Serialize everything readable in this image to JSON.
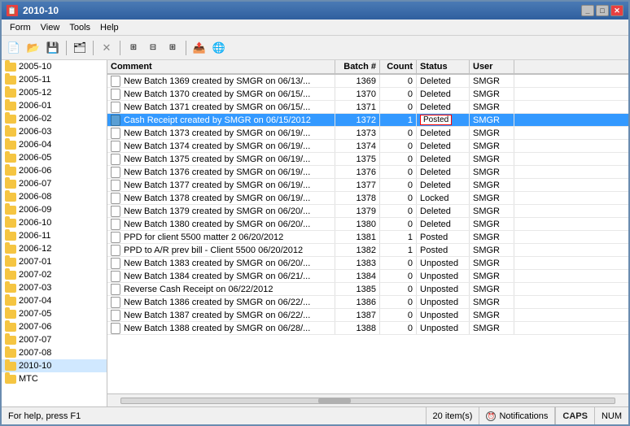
{
  "window": {
    "title": "2010-10",
    "icon": "🗒"
  },
  "menu": {
    "items": [
      "Form",
      "View",
      "Tools",
      "Help"
    ]
  },
  "toolbar": {
    "buttons": [
      "new",
      "open",
      "save",
      "separator",
      "folder",
      "separator",
      "delete",
      "separator",
      "grid1",
      "grid2",
      "grid3",
      "separator",
      "export",
      "globe"
    ]
  },
  "sidebar": {
    "items": [
      "2005-10",
      "2005-11",
      "2005-12",
      "2006-01",
      "2006-02",
      "2006-03",
      "2006-04",
      "2006-05",
      "2006-06",
      "2006-07",
      "2006-08",
      "2006-09",
      "2006-10",
      "2006-11",
      "2006-12",
      "2007-01",
      "2007-02",
      "2007-03",
      "2007-04",
      "2007-05",
      "2007-06",
      "2007-07",
      "2007-08",
      "2010-10",
      "MTC"
    ],
    "selected": "2010-10"
  },
  "table": {
    "columns": [
      {
        "key": "comment",
        "label": "Comment"
      },
      {
        "key": "batch",
        "label": "Batch #"
      },
      {
        "key": "count",
        "label": "Count"
      },
      {
        "key": "status",
        "label": "Status"
      },
      {
        "key": "user",
        "label": "User"
      }
    ],
    "rows": [
      {
        "comment": "New Batch 1369 created by SMGR on 06/13/...",
        "batch": "1369",
        "count": "0",
        "status": "Deleted",
        "user": "SMGR",
        "selected": false,
        "statusBoxed": false
      },
      {
        "comment": "New Batch 1370 created by SMGR on 06/15/...",
        "batch": "1370",
        "count": "0",
        "status": "Deleted",
        "user": "SMGR",
        "selected": false,
        "statusBoxed": false
      },
      {
        "comment": "New Batch 1371 created by SMGR on 06/15/...",
        "batch": "1371",
        "count": "0",
        "status": "Deleted",
        "user": "SMGR",
        "selected": false,
        "statusBoxed": false
      },
      {
        "comment": "Cash Receipt created by SMGR on 06/15/2012",
        "batch": "1372",
        "count": "1",
        "status": "Posted",
        "user": "SMGR",
        "selected": true,
        "statusBoxed": true
      },
      {
        "comment": "New Batch 1373 created by SMGR on 06/19/...",
        "batch": "1373",
        "count": "0",
        "status": "Deleted",
        "user": "SMGR",
        "selected": false,
        "statusBoxed": false
      },
      {
        "comment": "New Batch 1374 created by SMGR on 06/19/...",
        "batch": "1374",
        "count": "0",
        "status": "Deleted",
        "user": "SMGR",
        "selected": false,
        "statusBoxed": false
      },
      {
        "comment": "New Batch 1375 created by SMGR on 06/19/...",
        "batch": "1375",
        "count": "0",
        "status": "Deleted",
        "user": "SMGR",
        "selected": false,
        "statusBoxed": false
      },
      {
        "comment": "New Batch 1376 created by SMGR on 06/19/...",
        "batch": "1376",
        "count": "0",
        "status": "Deleted",
        "user": "SMGR",
        "selected": false,
        "statusBoxed": false
      },
      {
        "comment": "New Batch 1377 created by SMGR on 06/19/...",
        "batch": "1377",
        "count": "0",
        "status": "Deleted",
        "user": "SMGR",
        "selected": false,
        "statusBoxed": false
      },
      {
        "comment": "New Batch 1378 created by SMGR on 06/19/...",
        "batch": "1378",
        "count": "0",
        "status": "Locked",
        "user": "SMGR",
        "selected": false,
        "statusBoxed": false
      },
      {
        "comment": "New Batch 1379 created by SMGR on 06/20/...",
        "batch": "1379",
        "count": "0",
        "status": "Deleted",
        "user": "SMGR",
        "selected": false,
        "statusBoxed": false
      },
      {
        "comment": "New Batch 1380 created by SMGR on 06/20/...",
        "batch": "1380",
        "count": "0",
        "status": "Deleted",
        "user": "SMGR",
        "selected": false,
        "statusBoxed": false
      },
      {
        "comment": "PPD for client 5500 matter 2  06/20/2012",
        "batch": "1381",
        "count": "1",
        "status": "Posted",
        "user": "SMGR",
        "selected": false,
        "statusBoxed": false
      },
      {
        "comment": "PPD to A/R prev bill - Client 5500 06/20/2012",
        "batch": "1382",
        "count": "1",
        "status": "Posted",
        "user": "SMGR",
        "selected": false,
        "statusBoxed": false
      },
      {
        "comment": "New Batch 1383 created by SMGR on 06/20/...",
        "batch": "1383",
        "count": "0",
        "status": "Unposted",
        "user": "SMGR",
        "selected": false,
        "statusBoxed": false
      },
      {
        "comment": "New Batch 1384 created by SMGR on 06/21/...",
        "batch": "1384",
        "count": "0",
        "status": "Unposted",
        "user": "SMGR",
        "selected": false,
        "statusBoxed": false
      },
      {
        "comment": "Reverse Cash Receipt on 06/22/2012",
        "batch": "1385",
        "count": "0",
        "status": "Unposted",
        "user": "SMGR",
        "selected": false,
        "statusBoxed": false
      },
      {
        "comment": "New Batch 1386 created by SMGR on 06/22/...",
        "batch": "1386",
        "count": "0",
        "status": "Unposted",
        "user": "SMGR",
        "selected": false,
        "statusBoxed": false
      },
      {
        "comment": "New Batch 1387 created by SMGR on 06/22/...",
        "batch": "1387",
        "count": "0",
        "status": "Unposted",
        "user": "SMGR",
        "selected": false,
        "statusBoxed": false
      },
      {
        "comment": "New Batch 1388 created by SMGR on 06/28/...",
        "batch": "1388",
        "count": "0",
        "status": "Unposted",
        "user": "SMGR",
        "selected": false,
        "statusBoxed": false
      }
    ]
  },
  "status_bar": {
    "help_text": "For help, press F1",
    "item_count": "20 item(s)",
    "notifications": "Notifications",
    "caps": "CAPS",
    "num": "NUM"
  }
}
